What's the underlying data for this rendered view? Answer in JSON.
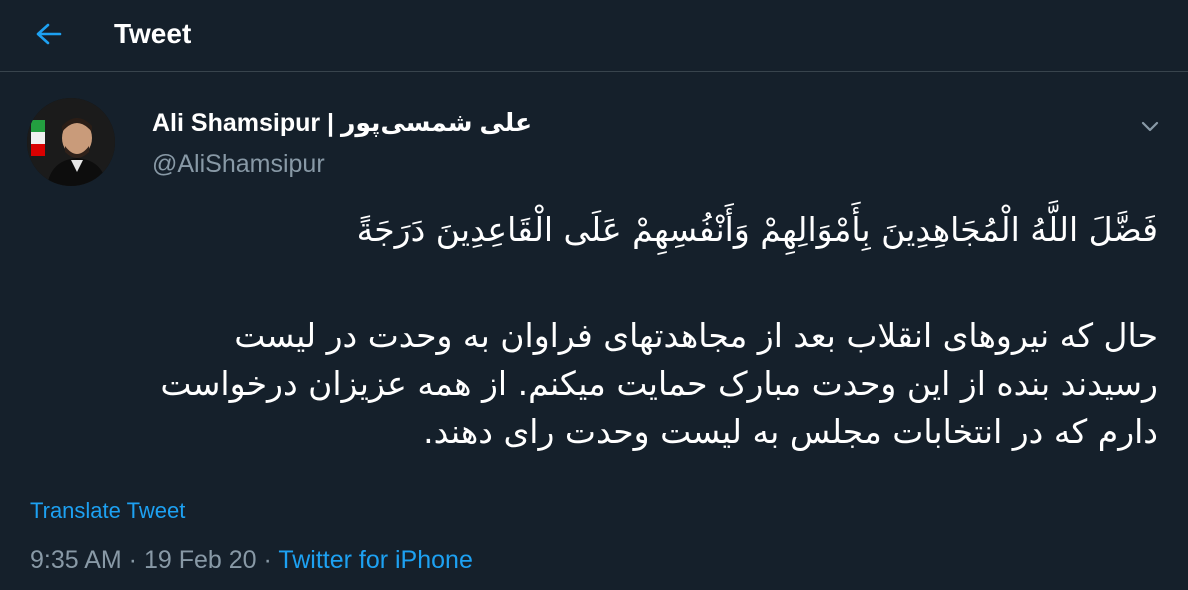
{
  "header": {
    "title": "Tweet",
    "back_icon": "arrow-left-icon",
    "accent": "#1da1f2"
  },
  "author": {
    "display_name": "Ali Shamsipur | علی شمسی‌پور",
    "handle": "@AliShamsipur",
    "avatar_icon": "avatar-photo",
    "menu_icon": "chevron-down-icon"
  },
  "tweet": {
    "verse": "فَضَّلَ اللَّهُ الْمُجَاهِدِينَ بِأَمْوَالِهِمْ وَأَنْفُسِهِمْ عَلَى الْقَاعِدِينَ دَرَجَةً",
    "text_lines": [
      "حال که نیروهای انقلاب بعد از مجاهدتهای فراوان به وحدت در لیست",
      "رسیدند بنده از این وحدت مبارک حمایت میکنم. از همه عزیزان درخواست",
      "دارم که در انتخابات مجلس به لیست وحدت رای دهند."
    ],
    "translate_label": "Translate Tweet"
  },
  "meta": {
    "time": "9:35 AM",
    "separator": " · ",
    "date": "19 Feb 20",
    "source": "Twitter for iPhone"
  },
  "colors": {
    "background": "#15202b",
    "secondary_text": "#8899a6",
    "divider": "#38444d",
    "link": "#1da1f2"
  }
}
